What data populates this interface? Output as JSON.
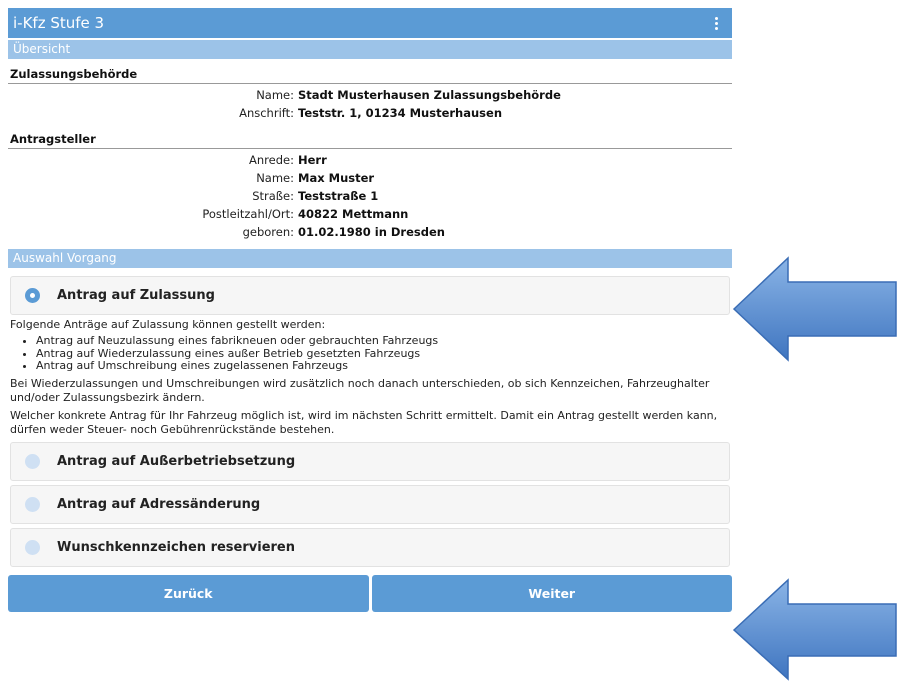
{
  "app": {
    "title": "i-Kfz Stufe 3"
  },
  "overview": {
    "section_label": "Übersicht",
    "authority": {
      "heading": "Zulassungsbehörde",
      "fields": [
        {
          "key": "Name:",
          "value": "Stadt Musterhausen Zulassungsbehörde"
        },
        {
          "key": "Anschrift:",
          "value": "Teststr. 1, 01234 Musterhausen"
        }
      ]
    },
    "applicant": {
      "heading": "Antragsteller",
      "fields": [
        {
          "key": "Anrede:",
          "value": "Herr"
        },
        {
          "key": "Name:",
          "value": "Max Muster"
        },
        {
          "key": "Straße:",
          "value": "Teststraße 1"
        },
        {
          "key": "Postleitzahl/Ort:",
          "value": "40822 Mettmann"
        },
        {
          "key": "geboren:",
          "value": "01.02.1980 in Dresden"
        }
      ]
    }
  },
  "selection": {
    "section_label": "Auswahl Vorgang",
    "options": [
      {
        "label": "Antrag auf Zulassung",
        "selected": true
      },
      {
        "label": "Antrag auf Außerbetriebsetzung",
        "selected": false
      },
      {
        "label": "Antrag auf Adressänderung",
        "selected": false
      },
      {
        "label": "Wunschkennzeichen reservieren",
        "selected": false
      }
    ],
    "info": {
      "intro": "Folgende Anträge auf Zulassung können gestellt werden:",
      "bullets": [
        "Antrag auf Neuzulassung eines fabrikneuen oder gebrauchten Fahrzeugs",
        "Antrag auf Wiederzulassung eines außer Betrieb gesetzten Fahrzeugs",
        "Antrag auf Umschreibung eines zugelassenen Fahrzeugs"
      ],
      "para1": "Bei Wiederzulassungen und Umschreibungen wird zusätzlich noch danach unterschieden, ob sich Kennzeichen, Fahrzeughalter und/oder Zulassungsbezirk ändern.",
      "para2": "Welcher konkrete Antrag für Ihr Fahrzeug möglich ist, wird im nächsten Schritt ermittelt. Damit ein Antrag gestellt werden kann, dürfen weder Steuer- noch Gebührenrückstände bestehen."
    }
  },
  "buttons": {
    "back": "Zurück",
    "next": "Weiter"
  },
  "colors": {
    "primary": "#5b9bd5",
    "section": "#9cc3e8",
    "arrow": "#4f86cc"
  }
}
